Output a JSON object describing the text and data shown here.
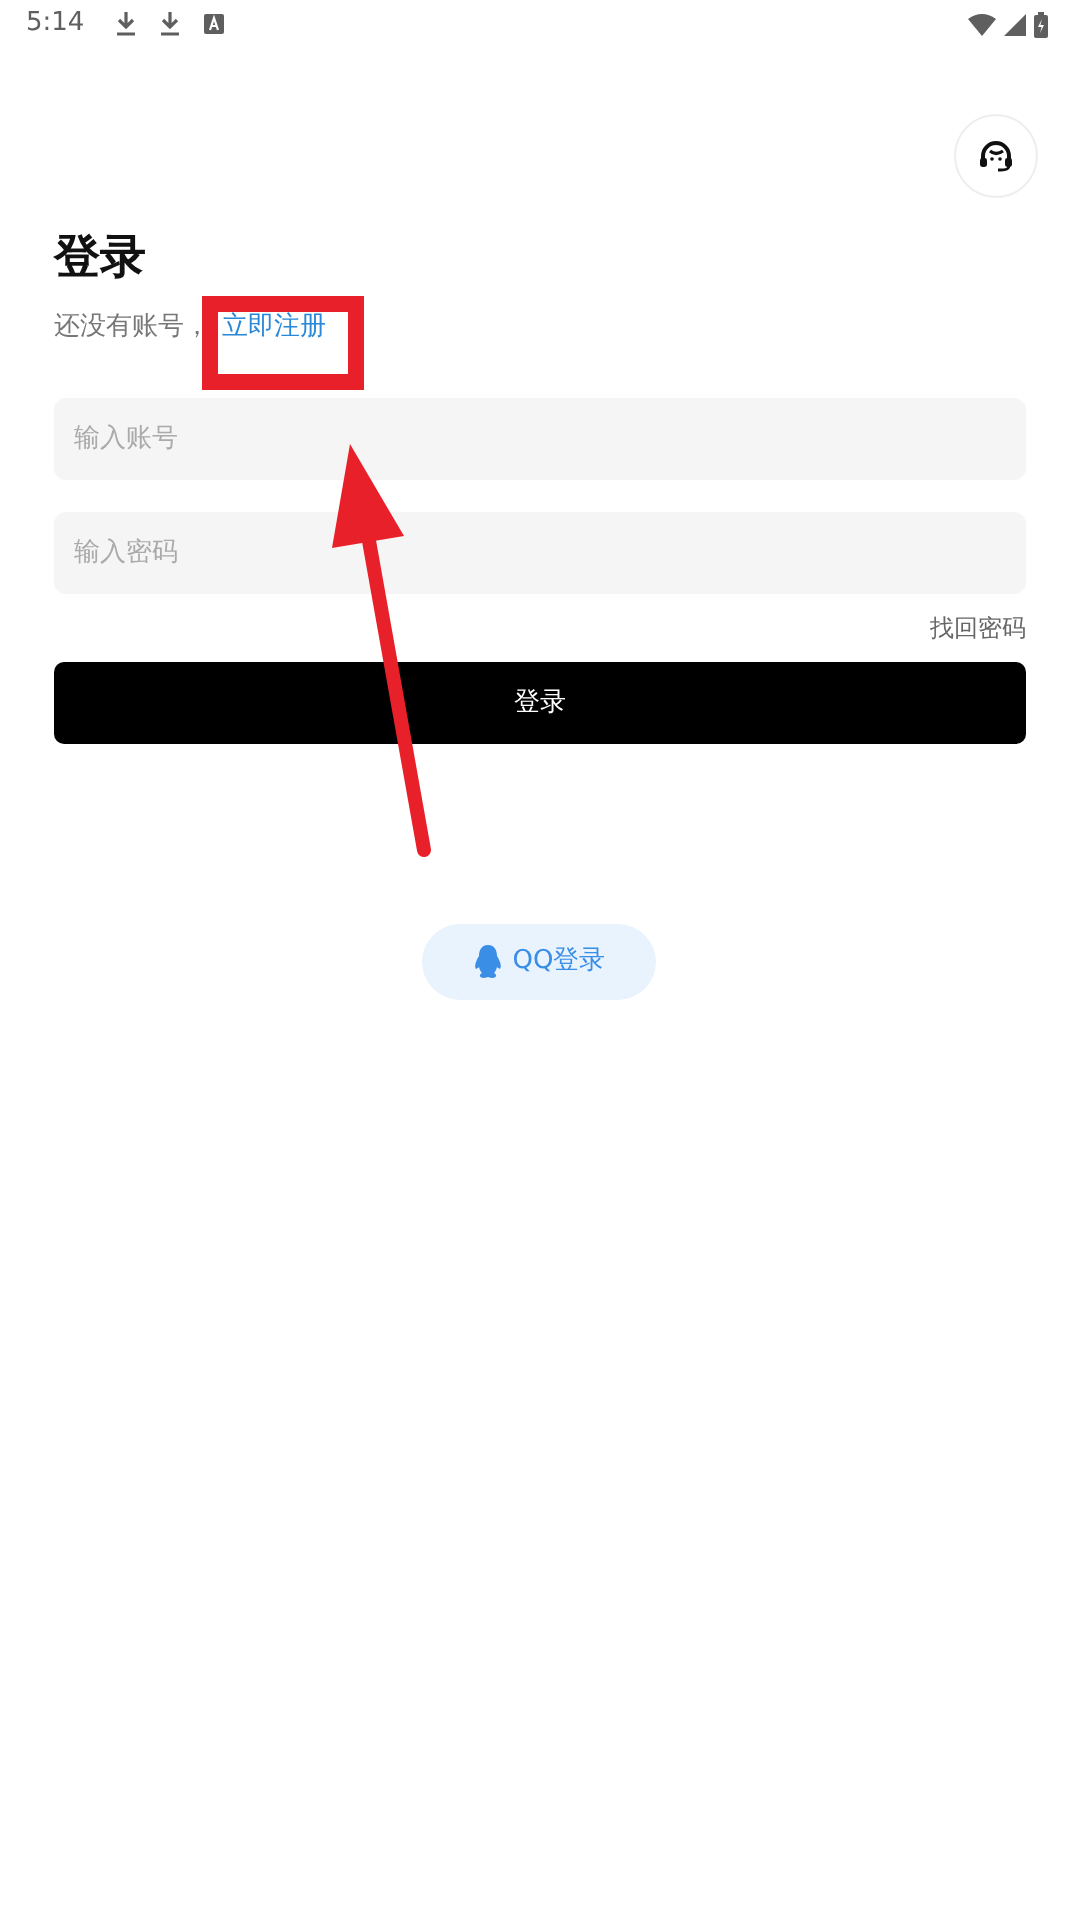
{
  "status_bar": {
    "time": "5:14"
  },
  "title": "登录",
  "register_prompt": {
    "text": "还没有账号，",
    "link": "立即注册"
  },
  "fields": [
    {
      "placeholder": "输入账号"
    },
    {
      "placeholder": "输入密码"
    }
  ],
  "forgot_password": "找回密码",
  "login_button": "登录",
  "qq_login_button": "QQ登录"
}
